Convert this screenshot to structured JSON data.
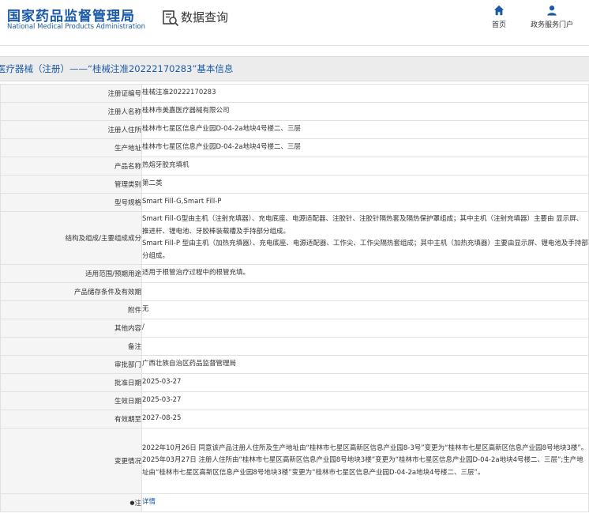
{
  "header": {
    "logo_cn": "国家药品监督管理局",
    "logo_en": "National Medical Products Administration",
    "search_label": "数据查询",
    "nav": [
      {
        "label": "首页",
        "icon": "home-icon"
      },
      {
        "label": "政务服务门户",
        "icon": "user-icon"
      }
    ]
  },
  "title": "医疗器械（注册）——“桂械注准20222170283”基本信息",
  "colors": {
    "brand": "#1a5aa6",
    "label_bg": "#f5f5f5",
    "border": "#e1e1e1",
    "title_bg": "#ececec"
  },
  "rows": [
    {
      "label": "注册证编号",
      "value": "桂械注准20222170283"
    },
    {
      "label": "注册人名称",
      "value": "桂林市美嘉医疗器械有限公司"
    },
    {
      "label": "注册人住所",
      "value": "桂林市七星区信息产业园D-04-2a地块4号楼二、三层"
    },
    {
      "label": "生产地址",
      "value": "桂林市七星区信息产业园D-04-2a地块4号楼二、三层"
    },
    {
      "label": "产品名称",
      "value": "热熔牙胶充填机"
    },
    {
      "label": "管理类别",
      "value": "第二类"
    },
    {
      "label": "型号规格",
      "value": "Smart Fill-G,Smart Fill-P"
    },
    {
      "label": "结构及组成/主要组成成分",
      "value": "Smart Fill-G型由主机（注射充填器）、充电底座、电源适配器、注胶针、注胶针隔热套及隔热保护罩组成；其中主机（注射充填器）主要由 显示屏、推进杆、锂电池、牙胶棒装载槽及手持部分组成。\nSmart Fill-P 型由主机（加热充填器）、充电底座、电源适配器、工作尖、工作尖隔热套组成；其中主机（加热充填器）主要由显示屏、锂电池及手持部分组成。"
    },
    {
      "label": "适用范围/预期用途",
      "value": "适用于根管治疗过程中的根管充填。"
    },
    {
      "label": "产品储存条件及有效期",
      "value": ""
    },
    {
      "label": "附件",
      "value": "无"
    },
    {
      "label": "其他内容",
      "value": "/"
    },
    {
      "label": "备注",
      "value": ""
    },
    {
      "label": "审批部门",
      "value": "广西壮族自治区药品监督管理局"
    },
    {
      "label": "批准日期",
      "value": "2025-03-27"
    },
    {
      "label": "生效日期",
      "value": "2025-03-27"
    },
    {
      "label": "有效期至",
      "value": "2027-08-25"
    },
    {
      "label": "变更情况",
      "value": "2022年10月26日 同意该产品注册人住所及生产地址由“桂林市七星区高新区信息产业园8-3号”变更为“桂林市七星区高新区信息产业园8号地块3楼”。\n2025年03月27日 注册人住所由“桂林市七星区高新区信息产业园8号地块3楼”变更为“桂林市七星区信息产业园D-04-2a地块4号楼二、三层”;生产地址由“桂林市七星区高新区信息产业园8号地块3楼”变更为“桂林市七星区信息产业园D-04-2a地块4号楼二、三层”。"
    }
  ],
  "note": {
    "label": "注",
    "link_text": "详情"
  }
}
